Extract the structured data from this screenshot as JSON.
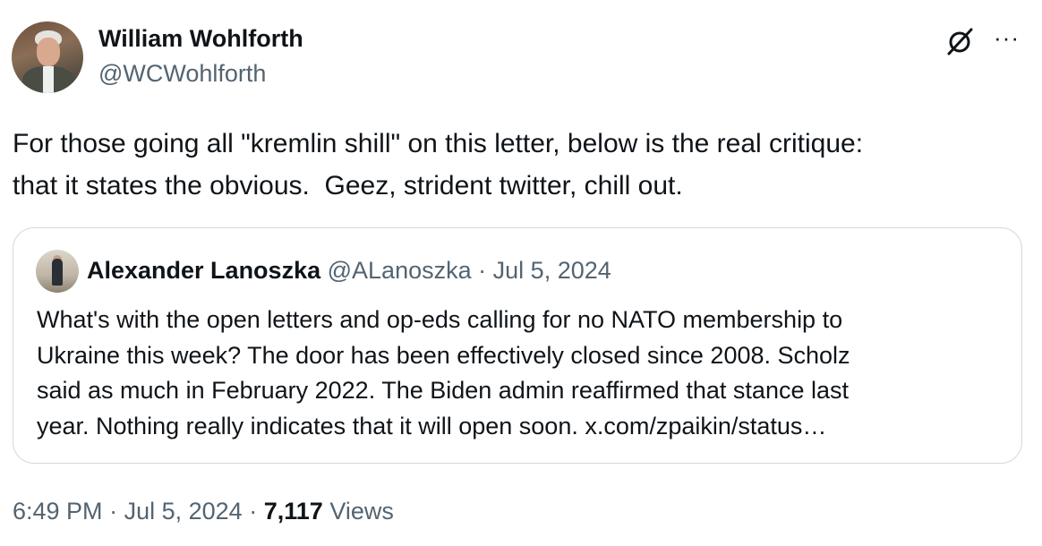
{
  "author": {
    "display_name": "William Wohlforth",
    "handle": "@WCWohlforth"
  },
  "icons": {
    "grok": "grok-icon",
    "more": "more-icon"
  },
  "tweet": {
    "text": "For those going all \"kremlin shill\" on this letter, below is the real critique:\nthat it states the obvious.  Geez, strident twitter, chill out."
  },
  "quoted_tweet": {
    "display_name": "Alexander Lanoszka",
    "handle": "@ALanoszka",
    "separator": "·",
    "date": "Jul 5, 2024",
    "text": "What's with the open letters and op-eds calling for no NATO membership to\nUkraine this week? The door has been effectively closed since 2008. Scholz\nsaid as much in February 2022. The Biden admin reaffirmed that stance last\nyear. Nothing really indicates that it will open soon. x.com/zpaikin/status…"
  },
  "footer": {
    "time": "6:49 PM",
    "separator1": "·",
    "date": "Jul 5, 2024",
    "separator2": "·",
    "views_count": "7,117",
    "views_label": "Views"
  }
}
